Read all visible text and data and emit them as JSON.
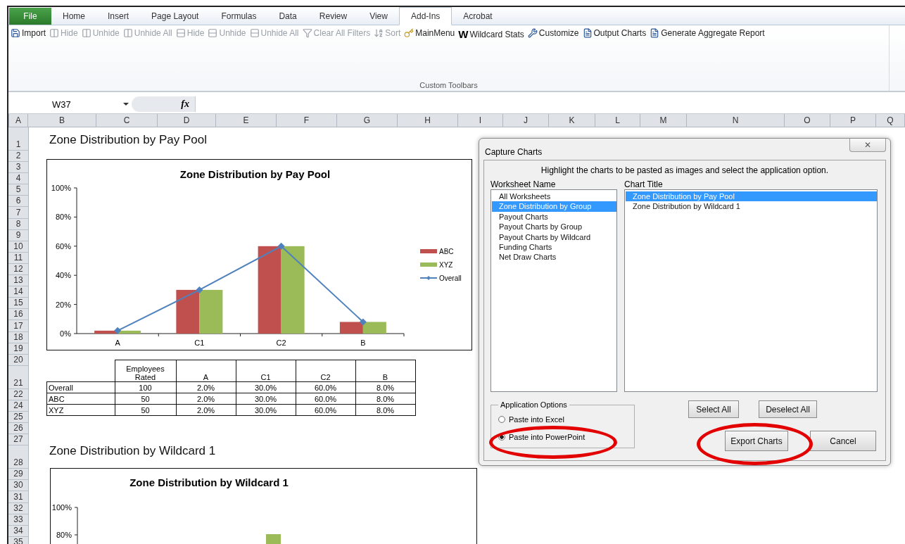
{
  "ribbon": {
    "file_tab": "File",
    "tabs": [
      {
        "label": "Home",
        "selected": false
      },
      {
        "label": "Insert",
        "selected": false
      },
      {
        "label": "Page Layout",
        "selected": false
      },
      {
        "label": "Formulas",
        "selected": false
      },
      {
        "label": "Data",
        "selected": false
      },
      {
        "label": "Review",
        "selected": false
      },
      {
        "label": "View",
        "selected": false
      },
      {
        "label": "Add-Ins",
        "selected": true
      },
      {
        "label": "Acrobat",
        "selected": false
      }
    ],
    "tools": [
      {
        "label": "Import",
        "disabled": false
      },
      {
        "label": "Hide",
        "disabled": true
      },
      {
        "label": "Unhide",
        "disabled": true
      },
      {
        "label": "Unhide All",
        "disabled": true
      },
      {
        "label": "Hide",
        "disabled": true
      },
      {
        "label": "Unhide",
        "disabled": true
      },
      {
        "label": "Unhide All",
        "disabled": true
      },
      {
        "label": "Clear All Filters",
        "disabled": true
      },
      {
        "label": "Sort",
        "disabled": true
      },
      {
        "label": "MainMenu",
        "disabled": false
      },
      {
        "label": "Wildcard Stats",
        "disabled": false,
        "glyph": "W"
      },
      {
        "label": "Customize",
        "disabled": false
      },
      {
        "label": "Output Charts",
        "disabled": false
      },
      {
        "label": "Generate Aggregate Report",
        "disabled": false
      }
    ],
    "group_label": "Custom Toolbars"
  },
  "formula_bar": {
    "name_box": "W37",
    "fx": "fx"
  },
  "columns": [
    "A",
    "B",
    "C",
    "D",
    "E",
    "F",
    "G",
    "H",
    "I",
    "J",
    "K",
    "L",
    "M",
    "N",
    "O",
    "P",
    "Q"
  ],
  "rows": [
    {
      "label": "1",
      "tall": true
    },
    {
      "label": "2",
      "tall": false
    },
    {
      "label": "3",
      "tall": false
    },
    {
      "label": "4",
      "tall": false
    },
    {
      "label": "5",
      "tall": false
    },
    {
      "label": "6",
      "tall": false
    },
    {
      "label": "7",
      "tall": false
    },
    {
      "label": "8",
      "tall": false
    },
    {
      "label": "9",
      "tall": false
    },
    {
      "label": "10",
      "tall": false
    },
    {
      "label": "11",
      "tall": false
    },
    {
      "label": "12",
      "tall": false
    },
    {
      "label": "13",
      "tall": false
    },
    {
      "label": "14",
      "tall": false
    },
    {
      "label": "15",
      "tall": false
    },
    {
      "label": "16",
      "tall": false
    },
    {
      "label": "17",
      "tall": false
    },
    {
      "label": "18",
      "tall": false
    },
    {
      "label": "19",
      "tall": false
    },
    {
      "label": "20",
      "tall": false
    },
    {
      "label": "21",
      "tall": true
    },
    {
      "label": "22",
      "tall": false
    },
    {
      "label": "24",
      "tall": false
    },
    {
      "label": "25",
      "tall": false
    },
    {
      "label": "26",
      "tall": false
    },
    {
      "label": "27",
      "tall": false
    },
    {
      "label": "28",
      "tall": true
    },
    {
      "label": "29",
      "tall": false
    },
    {
      "label": "30",
      "tall": false
    },
    {
      "label": "31",
      "tall": false
    },
    {
      "label": "32",
      "tall": false
    },
    {
      "label": "33",
      "tall": false
    },
    {
      "label": "34",
      "tall": false
    },
    {
      "label": "35",
      "tall": false
    }
  ],
  "sheet": {
    "title_1": "Zone Distribution by Pay Pool",
    "chart_1": {
      "chart_data": {
        "type": "bar",
        "title": "Zone Distribution by Pay Pool",
        "categories": [
          "A",
          "C1",
          "C2",
          "B"
        ],
        "series": [
          {
            "name": "ABC",
            "color": "#c0504d",
            "values": [
              2,
              30,
              60,
              8
            ]
          },
          {
            "name": "XYZ",
            "color": "#9bbb59",
            "values": [
              2,
              30,
              60,
              8
            ]
          },
          {
            "name": "Overall",
            "color": "#4f81bd",
            "values": [
              2,
              30,
              60,
              8
            ],
            "type": "line",
            "marker": "diamond"
          }
        ],
        "legend": "right",
        "ylim": [
          0,
          100
        ],
        "yticks": [
          {
            "value": 0,
            "label": "0%"
          },
          {
            "value": 20,
            "label": "20%"
          },
          {
            "value": 40,
            "label": "40%"
          },
          {
            "value": 60,
            "label": "60%"
          },
          {
            "value": 80,
            "label": "80%"
          },
          {
            "value": 100,
            "label": "100%"
          }
        ]
      }
    },
    "table": {
      "columns": [
        "",
        "Employees Rated",
        "A",
        "C1",
        "C2",
        "B"
      ],
      "rows": [
        [
          "Overall",
          "100",
          "2.0%",
          "30.0%",
          "60.0%",
          "8.0%"
        ],
        [
          "ABC",
          "50",
          "2.0%",
          "30.0%",
          "60.0%",
          "8.0%"
        ],
        [
          "XYZ",
          "50",
          "2.0%",
          "30.0%",
          "60.0%",
          "8.0%"
        ]
      ]
    },
    "title_2": "Zone Distribution by Wildcard 1",
    "chart_2": {
      "title": "Zone Distribution by Wildcard 1",
      "tick_labels": [
        "100%",
        "80%"
      ]
    }
  },
  "dialog": {
    "title": "Capture Charts",
    "close": "✕",
    "instruction": "Highlight the charts to be pasted as images and select the application option.",
    "worksheet_label": "Worksheet Name",
    "worksheets": [
      {
        "label": "All Worksheets",
        "selected": false
      },
      {
        "label": "Zone Distribution by Group",
        "selected": true
      },
      {
        "label": "Payout Charts",
        "selected": false
      },
      {
        "label": "Payout Charts by Group",
        "selected": false
      },
      {
        "label": "Payout Charts by Wildcard",
        "selected": false
      },
      {
        "label": "Funding Charts",
        "selected": false
      },
      {
        "label": "Net Draw Charts",
        "selected": false
      }
    ],
    "chart_label": "Chart Title",
    "charts": [
      {
        "label": "Zone Distribution by Pay Pool",
        "selected": true
      },
      {
        "label": "Zone Distribution by Wildcard 1",
        "selected": false
      }
    ],
    "options_label": "Application Options",
    "options": [
      {
        "label": "Paste into Excel",
        "selected": false
      },
      {
        "label": "Paste into PowerPoint",
        "selected": true
      }
    ],
    "buttons": [
      "Select All",
      "Deselect All",
      "Export Charts",
      "Cancel"
    ]
  },
  "markup": {
    "options_circled": true,
    "export_circled": true
  }
}
